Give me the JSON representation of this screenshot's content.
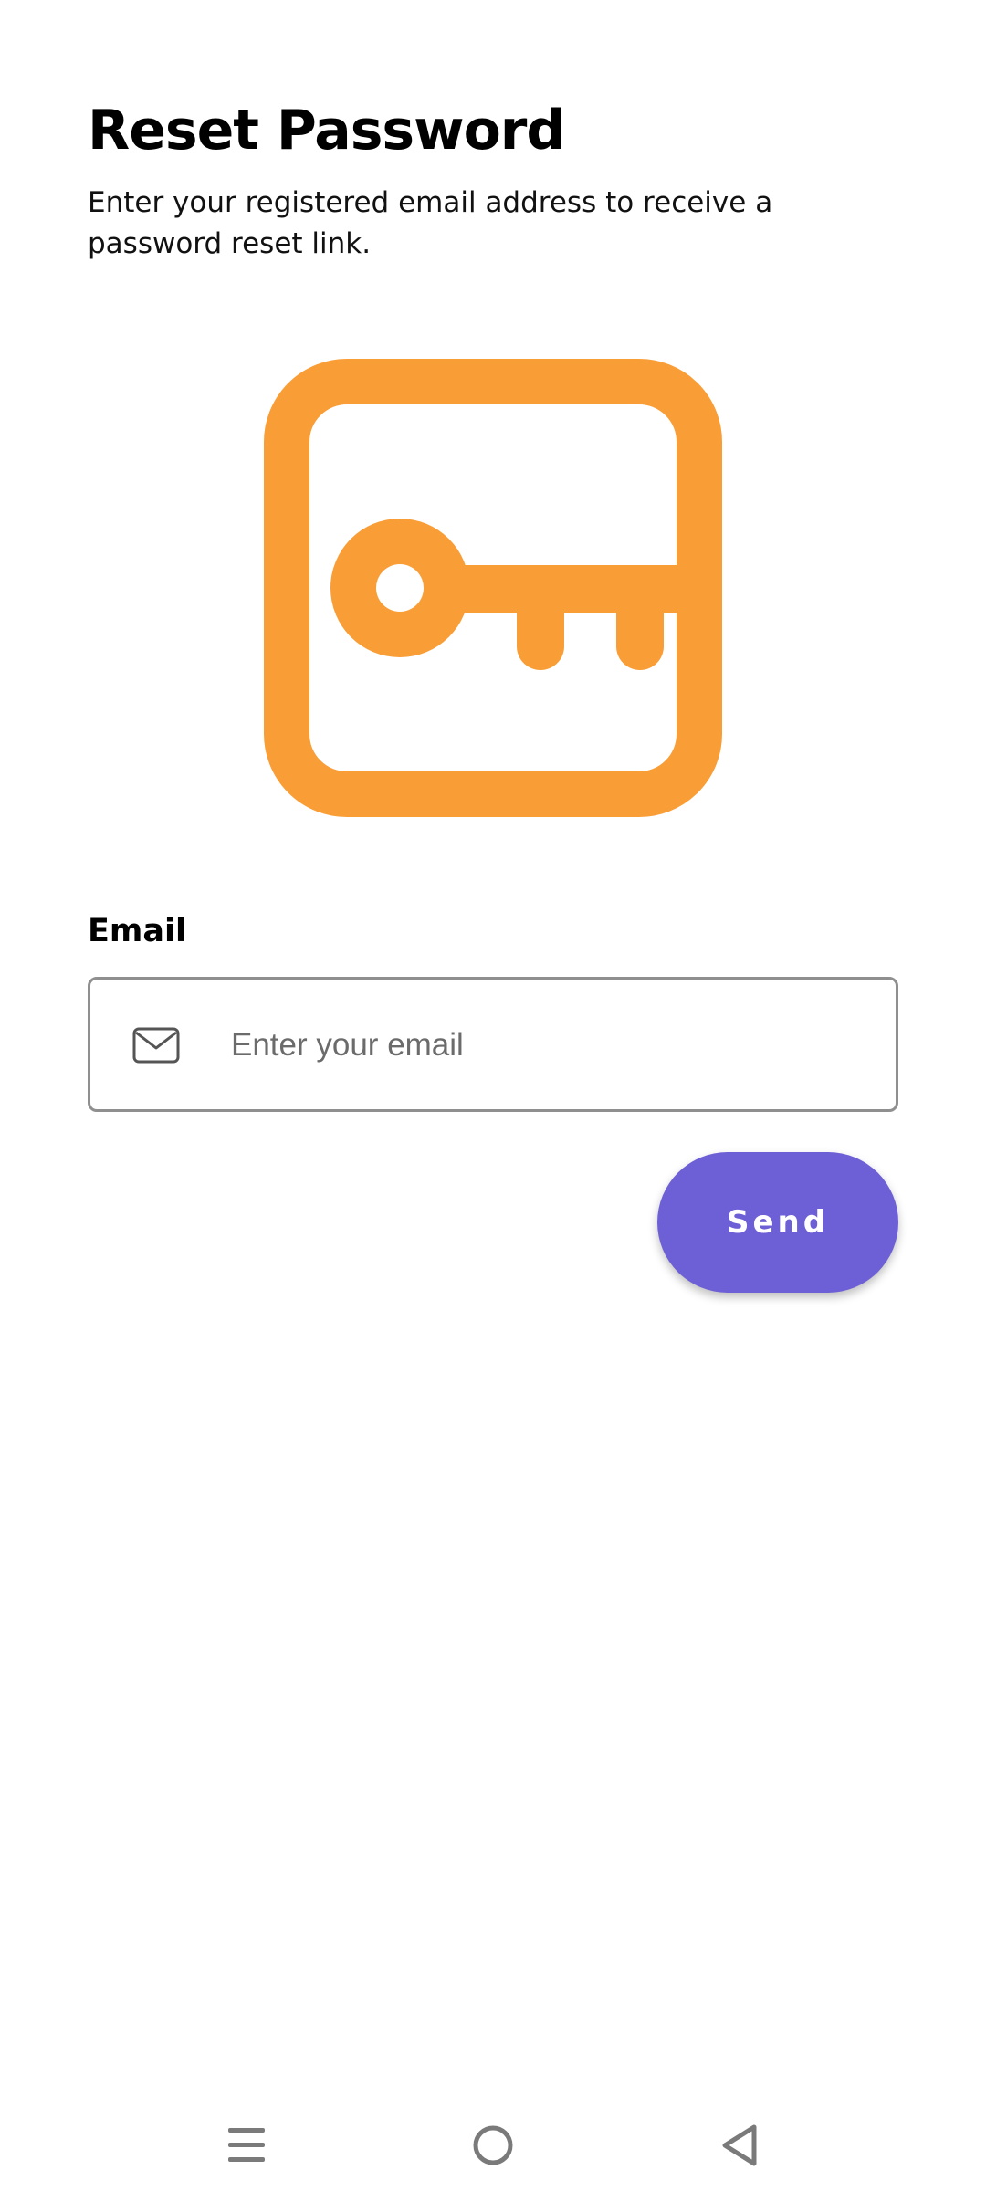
{
  "header": {
    "title": "Reset Password",
    "subtitle": "Enter your registered email address to receive a password reset link."
  },
  "hero": {
    "icon": "key-in-rounded-square-icon",
    "color": "#f99d36"
  },
  "email_field": {
    "label": "Email",
    "placeholder": "Enter your email",
    "value": "",
    "icon": "mail-icon"
  },
  "send_button": {
    "label": "Send",
    "color": "#6d5fd5"
  },
  "system_nav": {
    "items": [
      "menu-icon",
      "home-icon",
      "back-icon"
    ]
  }
}
